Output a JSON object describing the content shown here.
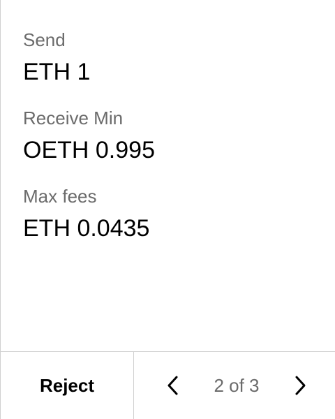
{
  "transaction": {
    "fields": [
      {
        "label": "Send",
        "value": "ETH 1"
      },
      {
        "label": "Receive Min",
        "value": "OETH 0.995"
      },
      {
        "label": "Max fees",
        "value": "ETH 0.0435"
      }
    ]
  },
  "footer": {
    "reject_label": "Reject",
    "page_indicator": "2 of 3",
    "prev_icon": "chevron-left-icon",
    "next_icon": "chevron-right-icon"
  },
  "colors": {
    "text_primary": "#000000",
    "text_secondary": "#6b6b6b",
    "divider": "#d0d0d0",
    "background": "#ffffff"
  }
}
